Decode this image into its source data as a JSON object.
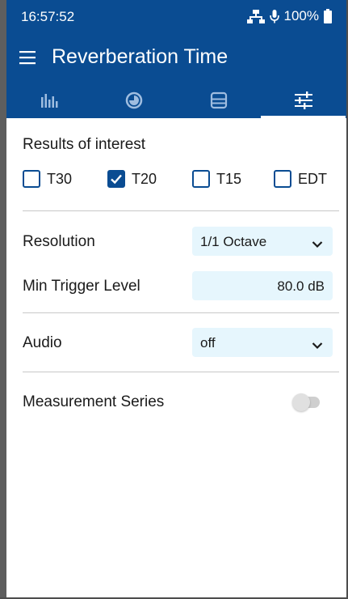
{
  "status_bar": {
    "time": "16:57:52",
    "battery": "100%"
  },
  "app_bar": {
    "title": "Reverberation Time",
    "menu_icon": "hamburger-icon"
  },
  "tabs": [
    {
      "icon": "bar-chart-icon",
      "active": false
    },
    {
      "icon": "pie-chart-icon",
      "active": false
    },
    {
      "icon": "table-icon",
      "active": false
    },
    {
      "icon": "sliders-icon",
      "active": true
    }
  ],
  "results": {
    "title": "Results of interest",
    "options": [
      {
        "label": "T30",
        "checked": false
      },
      {
        "label": "T20",
        "checked": true
      },
      {
        "label": "T15",
        "checked": false
      },
      {
        "label": "EDT",
        "checked": false
      }
    ]
  },
  "resolution": {
    "label": "Resolution",
    "value": "1/1 Octave"
  },
  "min_trigger": {
    "label": "Min Trigger Level",
    "value": "80.0 dB"
  },
  "audio": {
    "label": "Audio",
    "value": "off"
  },
  "measurement_series": {
    "label": "Measurement Series",
    "enabled": false
  },
  "colors": {
    "primary": "#0a4c92",
    "field_bg": "#e6f6fd",
    "divider": "#c8c8c8"
  }
}
